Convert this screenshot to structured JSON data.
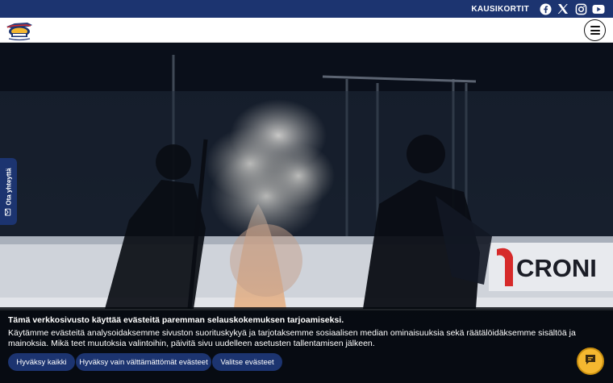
{
  "topbar": {
    "link_label": "KAUSIKORTIT",
    "social_icons": [
      "facebook-icon",
      "x-icon",
      "instagram-icon",
      "youtube-icon"
    ]
  },
  "navbar": {
    "logo_icon": "vaasan-sport-logo",
    "menu_icon": "hamburger-menu-icon"
  },
  "hero": {
    "board_text": "CRONI"
  },
  "contact_tab": {
    "label": "Ota yhteyttä",
    "icon": "mail-icon"
  },
  "cookie_banner": {
    "title": "Tämä verkkosivusto käyttää evästeitä paremman selauskokemuksen tarjoamiseksi.",
    "body": "Käytämme evästeitä analysoidaksemme sivuston suorituskykyä ja tarjotaksemme sosiaalisen median ominaisuuksia sekä räätälöidäksemme sisältöä ja mainoksia. Mikä teet muutoksia valintoihin, päivitä sivu uudelleen asetusten tallentamisen jälkeen.",
    "buttons": {
      "accept_all": "Hyväksy kaikki",
      "accept_necessary": "Hyväksy vain välttämättömät evästeet",
      "choose": "Valitse evästeet"
    }
  },
  "chat": {
    "icon": "chat-icon"
  },
  "colors": {
    "brand": "#1c3470",
    "chat": "#f5b830",
    "accent_red": "#d62a2a"
  }
}
